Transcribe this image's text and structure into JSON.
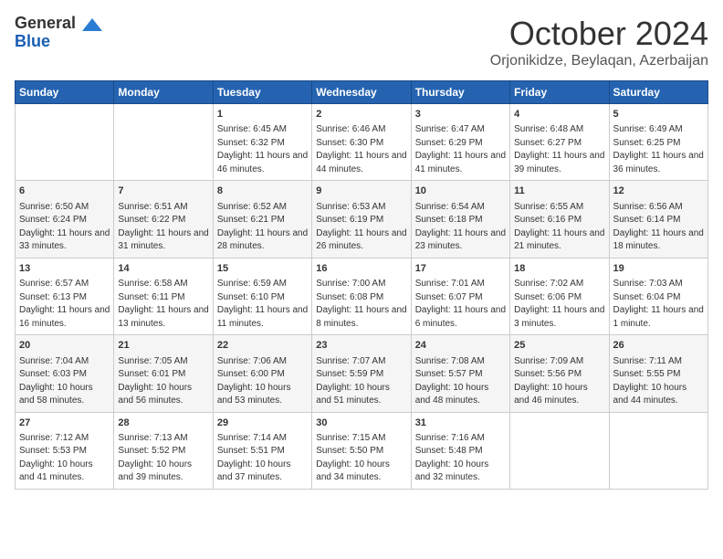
{
  "logo": {
    "general": "General",
    "blue": "Blue"
  },
  "title": {
    "month": "October 2024",
    "location": "Orjonikidze, Beylaqan, Azerbaijan"
  },
  "headers": [
    "Sunday",
    "Monday",
    "Tuesday",
    "Wednesday",
    "Thursday",
    "Friday",
    "Saturday"
  ],
  "weeks": [
    [
      {
        "day": "",
        "content": ""
      },
      {
        "day": "",
        "content": ""
      },
      {
        "day": "1",
        "content": "Sunrise: 6:45 AM\nSunset: 6:32 PM\nDaylight: 11 hours and 46 minutes."
      },
      {
        "day": "2",
        "content": "Sunrise: 6:46 AM\nSunset: 6:30 PM\nDaylight: 11 hours and 44 minutes."
      },
      {
        "day": "3",
        "content": "Sunrise: 6:47 AM\nSunset: 6:29 PM\nDaylight: 11 hours and 41 minutes."
      },
      {
        "day": "4",
        "content": "Sunrise: 6:48 AM\nSunset: 6:27 PM\nDaylight: 11 hours and 39 minutes."
      },
      {
        "day": "5",
        "content": "Sunrise: 6:49 AM\nSunset: 6:25 PM\nDaylight: 11 hours and 36 minutes."
      }
    ],
    [
      {
        "day": "6",
        "content": "Sunrise: 6:50 AM\nSunset: 6:24 PM\nDaylight: 11 hours and 33 minutes."
      },
      {
        "day": "7",
        "content": "Sunrise: 6:51 AM\nSunset: 6:22 PM\nDaylight: 11 hours and 31 minutes."
      },
      {
        "day": "8",
        "content": "Sunrise: 6:52 AM\nSunset: 6:21 PM\nDaylight: 11 hours and 28 minutes."
      },
      {
        "day": "9",
        "content": "Sunrise: 6:53 AM\nSunset: 6:19 PM\nDaylight: 11 hours and 26 minutes."
      },
      {
        "day": "10",
        "content": "Sunrise: 6:54 AM\nSunset: 6:18 PM\nDaylight: 11 hours and 23 minutes."
      },
      {
        "day": "11",
        "content": "Sunrise: 6:55 AM\nSunset: 6:16 PM\nDaylight: 11 hours and 21 minutes."
      },
      {
        "day": "12",
        "content": "Sunrise: 6:56 AM\nSunset: 6:14 PM\nDaylight: 11 hours and 18 minutes."
      }
    ],
    [
      {
        "day": "13",
        "content": "Sunrise: 6:57 AM\nSunset: 6:13 PM\nDaylight: 11 hours and 16 minutes."
      },
      {
        "day": "14",
        "content": "Sunrise: 6:58 AM\nSunset: 6:11 PM\nDaylight: 11 hours and 13 minutes."
      },
      {
        "day": "15",
        "content": "Sunrise: 6:59 AM\nSunset: 6:10 PM\nDaylight: 11 hours and 11 minutes."
      },
      {
        "day": "16",
        "content": "Sunrise: 7:00 AM\nSunset: 6:08 PM\nDaylight: 11 hours and 8 minutes."
      },
      {
        "day": "17",
        "content": "Sunrise: 7:01 AM\nSunset: 6:07 PM\nDaylight: 11 hours and 6 minutes."
      },
      {
        "day": "18",
        "content": "Sunrise: 7:02 AM\nSunset: 6:06 PM\nDaylight: 11 hours and 3 minutes."
      },
      {
        "day": "19",
        "content": "Sunrise: 7:03 AM\nSunset: 6:04 PM\nDaylight: 11 hours and 1 minute."
      }
    ],
    [
      {
        "day": "20",
        "content": "Sunrise: 7:04 AM\nSunset: 6:03 PM\nDaylight: 10 hours and 58 minutes."
      },
      {
        "day": "21",
        "content": "Sunrise: 7:05 AM\nSunset: 6:01 PM\nDaylight: 10 hours and 56 minutes."
      },
      {
        "day": "22",
        "content": "Sunrise: 7:06 AM\nSunset: 6:00 PM\nDaylight: 10 hours and 53 minutes."
      },
      {
        "day": "23",
        "content": "Sunrise: 7:07 AM\nSunset: 5:59 PM\nDaylight: 10 hours and 51 minutes."
      },
      {
        "day": "24",
        "content": "Sunrise: 7:08 AM\nSunset: 5:57 PM\nDaylight: 10 hours and 48 minutes."
      },
      {
        "day": "25",
        "content": "Sunrise: 7:09 AM\nSunset: 5:56 PM\nDaylight: 10 hours and 46 minutes."
      },
      {
        "day": "26",
        "content": "Sunrise: 7:11 AM\nSunset: 5:55 PM\nDaylight: 10 hours and 44 minutes."
      }
    ],
    [
      {
        "day": "27",
        "content": "Sunrise: 7:12 AM\nSunset: 5:53 PM\nDaylight: 10 hours and 41 minutes."
      },
      {
        "day": "28",
        "content": "Sunrise: 7:13 AM\nSunset: 5:52 PM\nDaylight: 10 hours and 39 minutes."
      },
      {
        "day": "29",
        "content": "Sunrise: 7:14 AM\nSunset: 5:51 PM\nDaylight: 10 hours and 37 minutes."
      },
      {
        "day": "30",
        "content": "Sunrise: 7:15 AM\nSunset: 5:50 PM\nDaylight: 10 hours and 34 minutes."
      },
      {
        "day": "31",
        "content": "Sunrise: 7:16 AM\nSunset: 5:48 PM\nDaylight: 10 hours and 32 minutes."
      },
      {
        "day": "",
        "content": ""
      },
      {
        "day": "",
        "content": ""
      }
    ]
  ]
}
